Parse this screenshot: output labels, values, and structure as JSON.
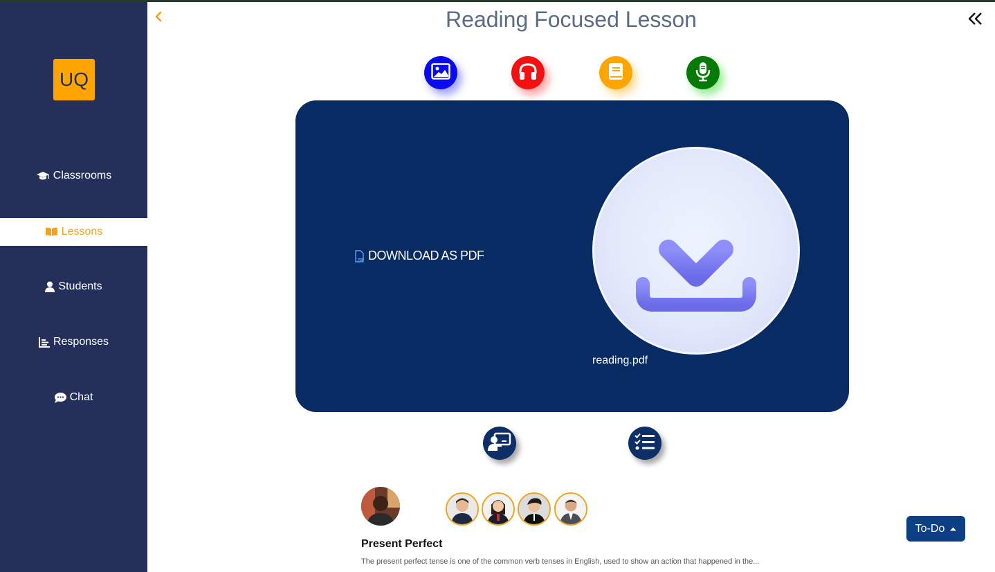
{
  "app": {
    "logo_text": "UQ"
  },
  "sidebar": {
    "items": [
      {
        "label": "Classrooms",
        "icon": "graduation-cap-icon",
        "active": false
      },
      {
        "label": "Lessons",
        "icon": "book-open-icon",
        "active": true
      },
      {
        "label": "Students",
        "icon": "user-icon",
        "active": false
      },
      {
        "label": "Responses",
        "icon": "bar-chart-icon",
        "active": false
      },
      {
        "label": "Chat",
        "icon": "chat-bubble-icon",
        "active": false
      }
    ]
  },
  "header": {
    "title": "Reading Focused Lesson"
  },
  "modes": [
    {
      "name": "image",
      "icon": "image-icon",
      "color": "#0a0af0"
    },
    {
      "name": "audio",
      "icon": "headphones-icon",
      "color": "#f21010"
    },
    {
      "name": "reading",
      "icon": "book-icon",
      "color": "#ffa500"
    },
    {
      "name": "speaking",
      "icon": "microphone-icon",
      "color": "#067a06"
    }
  ],
  "material": {
    "download_label": "DOWNLOAD AS PDF",
    "file_name": "reading.pdf"
  },
  "lesson": {
    "title": "Present Perfect",
    "description": "The present perfect tense is one of the common verb tenses in English, used to show an action that happened in the..."
  },
  "todo_button": {
    "label": "To-Do"
  },
  "colors": {
    "sidebar": "#242f5a",
    "accent": "#f3a31b",
    "card": "#072b62"
  }
}
